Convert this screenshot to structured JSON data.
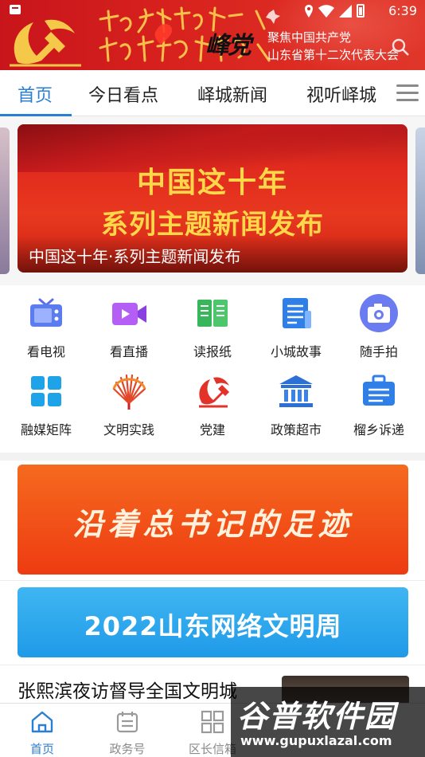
{
  "status_bar": {
    "time": "6:39"
  },
  "header": {
    "brand": "峰党",
    "congress_line1": "聚焦中国共产党",
    "congress_line2": "山东省第十二次代表大会"
  },
  "tabs": [
    {
      "label": "首页",
      "active": true
    },
    {
      "label": "今日看点",
      "active": false
    },
    {
      "label": "峄城新闻",
      "active": false
    },
    {
      "label": "视听峄城",
      "active": false
    }
  ],
  "carousel": {
    "slide_line1": "中国这十年",
    "slide_line2": "系列主题新闻发布",
    "caption": "中国这十年·系列主题新闻发布"
  },
  "grid": [
    {
      "label": "看电视",
      "icon": "tv-icon"
    },
    {
      "label": "看直播",
      "icon": "live-video-icon"
    },
    {
      "label": "读报纸",
      "icon": "newspaper-icon"
    },
    {
      "label": "小城故事",
      "icon": "document-icon"
    },
    {
      "label": "随手拍",
      "icon": "camera-icon"
    },
    {
      "label": "融媒矩阵",
      "icon": "matrix-grid-icon"
    },
    {
      "label": "文明实践",
      "icon": "fan-icon"
    },
    {
      "label": "党建",
      "icon": "party-emblem-icon"
    },
    {
      "label": "政策超市",
      "icon": "government-building-icon"
    },
    {
      "label": "榴乡诉递",
      "icon": "briefcase-icon"
    }
  ],
  "promos": {
    "promo1": "沿着总书记的足迹",
    "promo2": "2022山东网络文明周"
  },
  "news": {
    "headline": "张熙滨夜访督导全国文明城"
  },
  "bottom_nav": [
    {
      "label": "首页",
      "active": true
    },
    {
      "label": "政务号",
      "active": false
    },
    {
      "label": "区长信箱",
      "active": false
    }
  ],
  "watermark": {
    "title": "谷普软件园",
    "url": "www.gupuxlazal.com"
  },
  "colors": {
    "accent": "#2a7fd4",
    "header_red": "#d9231e",
    "promo_orange": "#ee3b12",
    "promo_blue": "#1f9ae8"
  }
}
